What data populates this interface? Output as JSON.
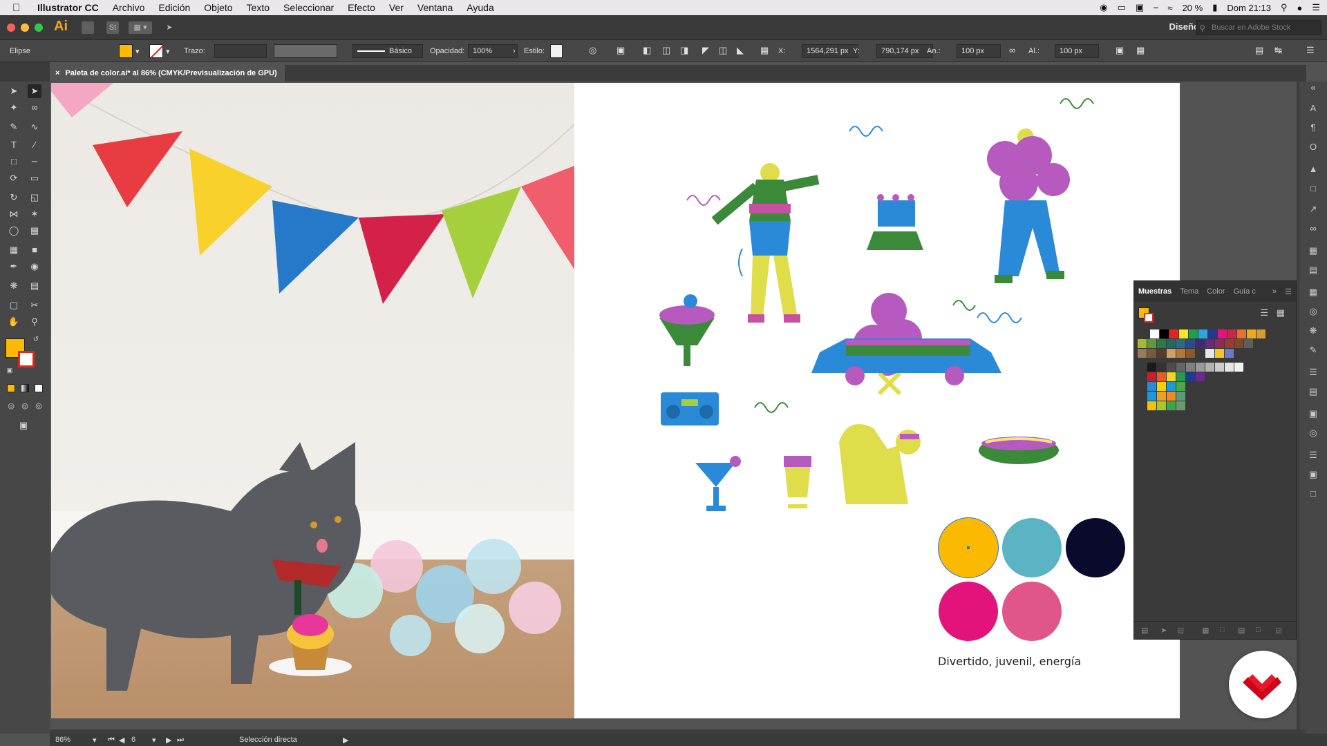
{
  "menubar": {
    "app_name": "Illustrator CC",
    "items": [
      "Archivo",
      "Edición",
      "Objeto",
      "Texto",
      "Seleccionar",
      "Efecto",
      "Ver",
      "Ventana",
      "Ayuda"
    ],
    "battery": "20 %",
    "clock": "Dom 21:13"
  },
  "apptoolbar": {
    "logo": "Ai",
    "br": "Br",
    "st": "St",
    "workspace": "Diseño",
    "stock_placeholder": "Buscar en Adobe Stock"
  },
  "control": {
    "selection_type": "Elipse",
    "stroke_label": "Trazo:",
    "brush_label": "Básico",
    "opacity_label": "Opacidad:",
    "opacity_value": "100%",
    "style_label": "Estilo:",
    "x_label": "X:",
    "x_value": "1564,291 px",
    "y_label": "Y:",
    "y_value": "790,174 px",
    "w_label": "An.:",
    "w_value": "100 px",
    "h_label": "Al.:",
    "h_value": "100 px"
  },
  "document": {
    "tab_title": "Paleta de color.ai* al 86% (CMYK/Previsualización de GPU)",
    "close_glyph": "×"
  },
  "artboard": {
    "caption": "Divertido, juvenil, energía",
    "palette": [
      "#fbb900",
      "#5bb4c4",
      "#0a0b2c",
      "#e2137b",
      "#e0568a"
    ],
    "bunting_colors": [
      "#f3a7c3",
      "#e83c43",
      "#f8d22a",
      "#2678c8",
      "#d4214a",
      "#a6cf3e",
      "#f05d6c"
    ]
  },
  "swatches_panel": {
    "tabs": [
      "Muestras",
      "Tema",
      "Color",
      "Guía c"
    ],
    "active_tab": "Muestras",
    "row1": [
      "#ffffff",
      "#000000",
      "#e5241e",
      "#f4ea1e",
      "#1aa346",
      "#2aa7df",
      "#26378c",
      "#e3137e",
      "#c62b3b",
      "#e8712a",
      "#f2a51f",
      "#d99b2b"
    ],
    "row2": [
      "#a8b82f",
      "#5e9a3c",
      "#287a46",
      "#1f6b5c",
      "#2a6b88",
      "#2e4a8c",
      "#3b2c7a",
      "#6a2a7a",
      "#8c2a5e",
      "#9c3a3a",
      "#7a4a2a",
      "#5e5e5e"
    ],
    "row3": [
      "#9a7a5a",
      "#7a5a3a",
      "#5a3a2a",
      "#c9a26a",
      "#b07a3a",
      "#8a5a2a",
      "#3a3a3a",
      "#e8e8e8",
      "#f4c81e",
      "#6a7ac8"
    ],
    "gray_group": [
      "#1a1a1a",
      "#333333",
      "#4d4d4d",
      "#666666",
      "#808080",
      "#999999",
      "#b3b3b3",
      "#cccccc",
      "#e6e6e6",
      "#f2f2f2"
    ],
    "bright_group": [
      "#c8202a",
      "#e5601e",
      "#f4d22a",
      "#2a9a4a",
      "#1e3c8c",
      "#6a2a8a"
    ],
    "cool_group": [
      "#2a8ad8",
      "#f4d200",
      "#1a9ad8",
      "#4aa84a"
    ],
    "yellow_group": [
      "#1a9ad8",
      "#e8a02a",
      "#f08a1e",
      "#5a9a7a"
    ],
    "green_group": [
      "#f4c200",
      "#a8c82a",
      "#3aa84a",
      "#6a9a6a"
    ]
  },
  "statusbar": {
    "zoom": "86%",
    "artboard_number": "6",
    "tool_name": "Selección directa"
  }
}
